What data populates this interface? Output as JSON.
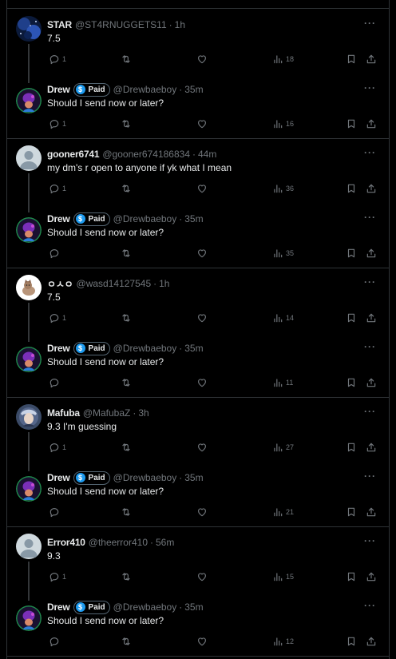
{
  "badge_label": "Paid",
  "badge_symbol": "$",
  "more_symbol": "···",
  "threads": [
    {
      "reply": {
        "name": "STAR",
        "handle": "@ST4RNUGGETS11",
        "time": "1h",
        "text": "7.5",
        "replies": "1",
        "views": "18",
        "avatar": "night-sky"
      },
      "drew": {
        "name": "Drew",
        "handle": "@Drewbaeboy",
        "time": "35m",
        "text": "Should I send now or later?",
        "replies": "1",
        "views": "16"
      }
    },
    {
      "reply": {
        "name": "gooner6741",
        "handle": "@gooner674186834",
        "time": "44m",
        "text": "my dm's r open to anyone if yk what I mean",
        "replies": "1",
        "views": "36",
        "avatar": "default"
      },
      "drew": {
        "name": "Drew",
        "handle": "@Drewbaeboy",
        "time": "35m",
        "text": "Should I send now or later?",
        "replies": "",
        "views": "35"
      }
    },
    {
      "reply": {
        "name": "ㅇㅅㅇ",
        "handle": "@wasd14127545",
        "time": "1h",
        "text": "7.5",
        "replies": "1",
        "views": "14",
        "avatar": "cat"
      },
      "drew": {
        "name": "Drew",
        "handle": "@Drewbaeboy",
        "time": "35m",
        "text": "Should I send now or later?",
        "replies": "",
        "views": "11"
      }
    },
    {
      "reply": {
        "name": "Mafuba",
        "handle": "@MafubaZ",
        "time": "3h",
        "text": "9.3 I'm guessing",
        "replies": "1",
        "views": "27",
        "avatar": "anime"
      },
      "drew": {
        "name": "Drew",
        "handle": "@Drewbaeboy",
        "time": "35m",
        "text": "Should I send now or later?",
        "replies": "",
        "views": "21"
      }
    },
    {
      "reply": {
        "name": "Error410",
        "handle": "@theerror410",
        "time": "56m",
        "text": "9.3",
        "replies": "1",
        "views": "15",
        "avatar": "default"
      },
      "drew": {
        "name": "Drew",
        "handle": "@Drewbaeboy",
        "time": "35m",
        "text": "Should I send now or later?",
        "replies": "",
        "views": "12"
      }
    }
  ],
  "colors": {
    "background": "#000000",
    "text": "#e7e9ea",
    "muted": "#71767b",
    "border": "#2f3336",
    "accent": "#1d9bf0"
  }
}
